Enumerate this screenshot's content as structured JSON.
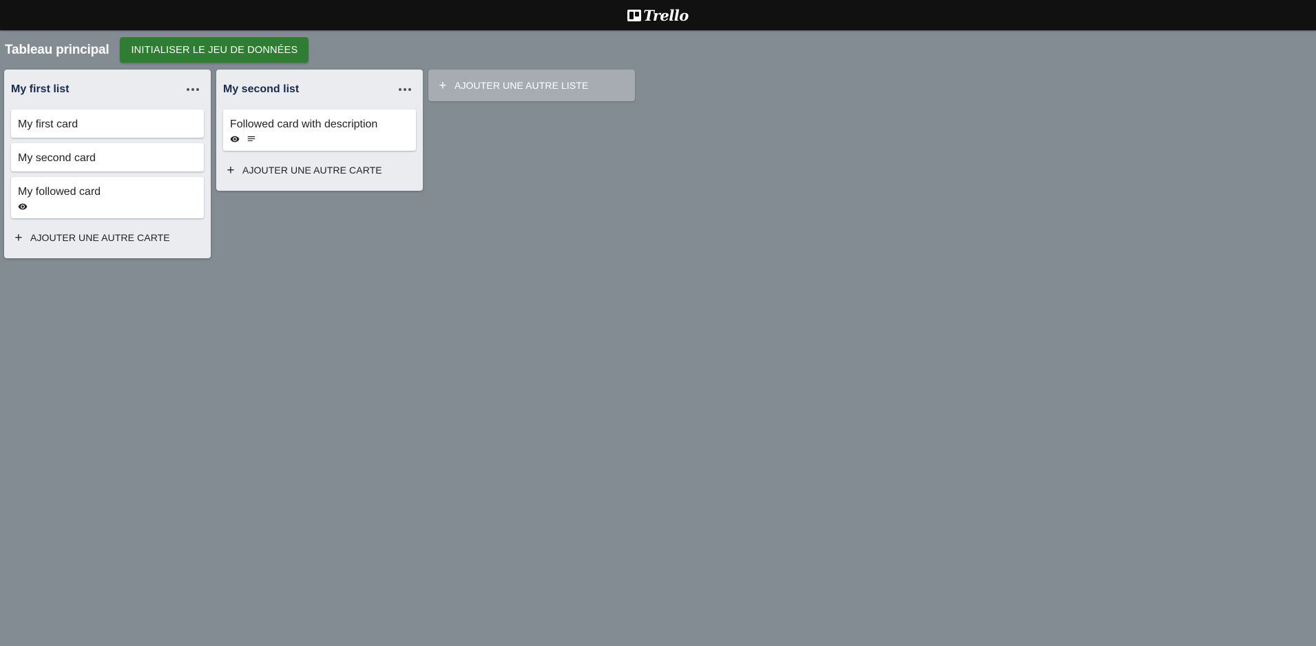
{
  "app": {
    "logo_text": "Trello"
  },
  "board": {
    "title": "Tableau principal",
    "init_button_label": "INITIALISER LE JEU DE DONNÉES",
    "add_list_label": "AJOUTER UNE AUTRE LISTE"
  },
  "lists": [
    {
      "title": "My first list",
      "add_card_label": "AJOUTER UNE AUTRE CARTE",
      "cards": [
        {
          "title": "My first card",
          "followed": false,
          "has_description": false
        },
        {
          "title": "My second card",
          "followed": false,
          "has_description": false
        },
        {
          "title": "My followed card",
          "followed": true,
          "has_description": false
        }
      ]
    },
    {
      "title": "My second list",
      "add_card_label": "AJOUTER UNE AUTRE CARTE",
      "cards": [
        {
          "title": "Followed card with description",
          "followed": true,
          "has_description": true
        }
      ]
    }
  ],
  "colors": {
    "topbar": "#111111",
    "board_background": "#838b93",
    "primary_button": "#2e7d32",
    "list_background": "#ebecf0"
  },
  "icons": {
    "follow": "eye-icon",
    "description": "description-icon",
    "list_menu": "more-horizontal-icon",
    "add": "plus-icon"
  }
}
